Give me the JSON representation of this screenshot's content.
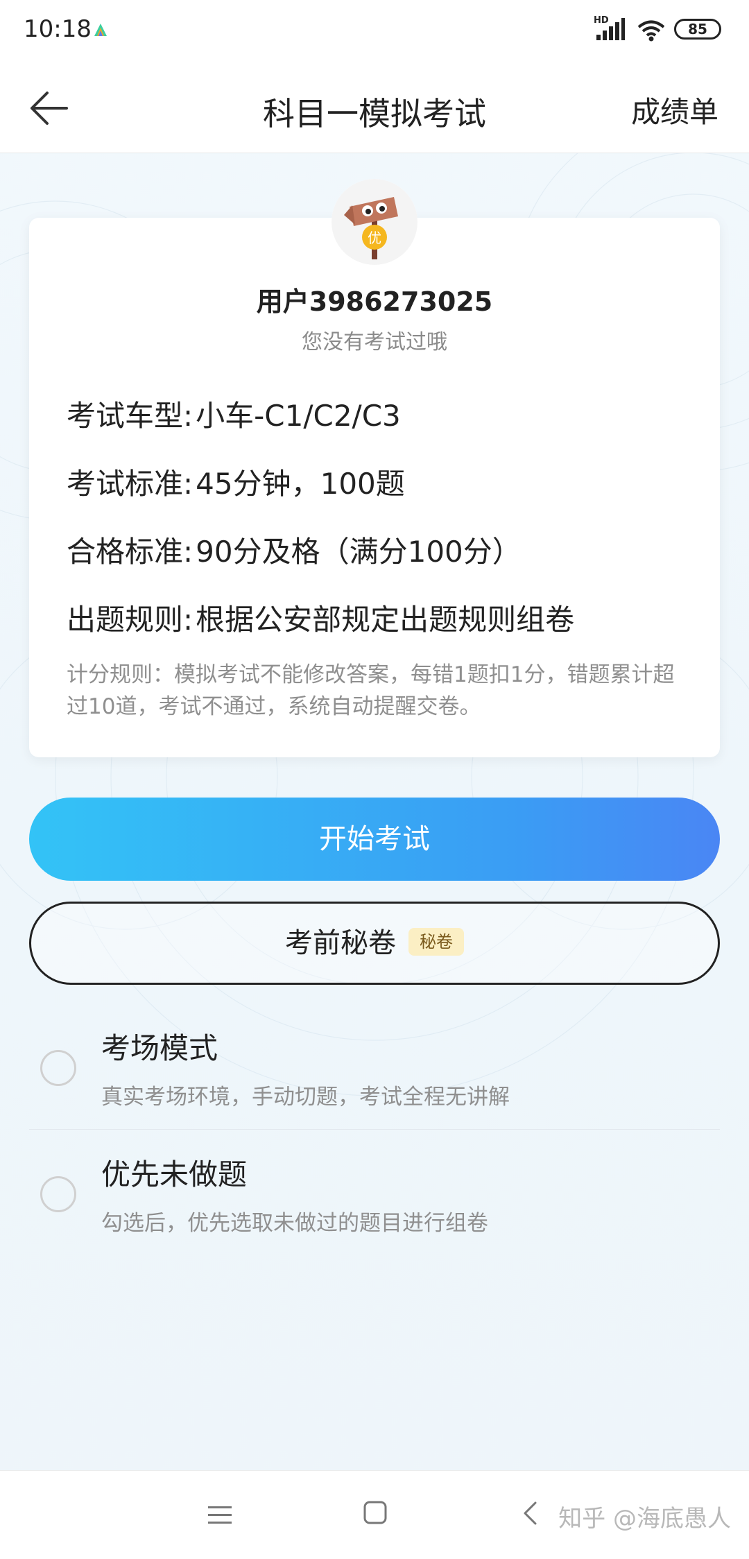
{
  "status_bar": {
    "time": "10:18",
    "network_label": "HD",
    "battery": "85",
    "icons": [
      "app-icon",
      "signal-icon",
      "wifi-icon",
      "battery-icon"
    ]
  },
  "header": {
    "title": "科目一模拟考试",
    "right_link": "成绩单",
    "back_icon": "back-arrow-icon"
  },
  "card": {
    "avatar_badge": "优",
    "username": "用户3986273025",
    "exam_note": "您没有考试过哦",
    "rows": [
      {
        "label": "考试车型:",
        "value": "小车-C1/C2/C3"
      },
      {
        "label": "考试标准:",
        "value": "45分钟，100题"
      },
      {
        "label": "合格标准:",
        "value": "90分及格（满分100分）"
      },
      {
        "label": "出题规则:",
        "value": "根据公安部规定出题规则组卷"
      }
    ],
    "rule_note": "计分规则：模拟考试不能修改答案，每错1题扣1分，错题累计超过10道，考试不通过，系统自动提醒交卷。"
  },
  "buttons": {
    "start": "开始考试",
    "secret": "考前秘卷",
    "secret_badge": "秘卷"
  },
  "options": [
    {
      "title": "考场模式",
      "desc": "真实考场环境，手动切题，考试全程无讲解",
      "checked": false
    },
    {
      "title": "优先未做题",
      "desc": "勾选后，优先选取未做过的题目进行组卷",
      "checked": false
    }
  ],
  "nav": {
    "icons": [
      "menu-icon",
      "home-icon",
      "back-icon"
    ]
  },
  "watermark": "知乎 @海底愚人",
  "colors": {
    "start_gradient_from": "#33c3f6",
    "start_gradient_to": "#4a86f4",
    "badge_bg": "#fbefc4",
    "avatar_badge": "#f5b71f"
  }
}
